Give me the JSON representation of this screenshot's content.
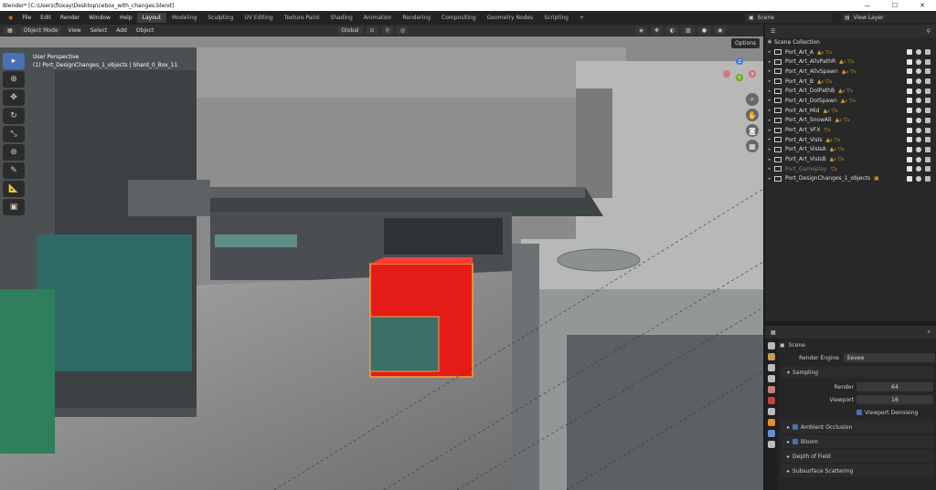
{
  "window": {
    "title": "Blender* [C:\\Users\\floxay\\Desktop\\cebox_with_changes.blend]",
    "controls": [
      "—",
      "☐",
      "✕"
    ]
  },
  "menu": {
    "items": [
      "File",
      "Edit",
      "Render",
      "Window",
      "Help"
    ],
    "workspaces": [
      "Layout",
      "Modeling",
      "Sculpting",
      "UV Editing",
      "Texture Paint",
      "Shading",
      "Animation",
      "Rendering",
      "Compositing",
      "Geometry Nodes",
      "Scripting"
    ],
    "add_tab": "+",
    "scene": "Scene",
    "view_layer": "View Layer"
  },
  "viewport": {
    "mode": "Object Mode",
    "menus": [
      "View",
      "Select",
      "Add",
      "Object"
    ],
    "orientation": "Global",
    "options_label": "Options",
    "view_name": "User Perspective",
    "object_info": "(1) Port_DesignChanges_1_objects | Shard_0_Box_11",
    "gizmo": {
      "x": "X",
      "y": "Y",
      "z": "Z"
    }
  },
  "outliner": {
    "root": "Scene Collection",
    "rows": [
      {
        "name": "Port_Art_A",
        "tags": "▲₈ ▽₈"
      },
      {
        "name": "Port_Art_AllvPathR",
        "tags": "▲₁ ▽₈"
      },
      {
        "name": "Port_Art_AllvSpawn",
        "tags": "▲₈ ▽₈"
      },
      {
        "name": "Port_Art_B",
        "tags": "▲₈ ▽₈"
      },
      {
        "name": "Port_Art_DolPathB",
        "tags": "▲₈ ▽₈"
      },
      {
        "name": "Port_Art_DolSpawn",
        "tags": "▲₈ ▽₈"
      },
      {
        "name": "Port_Art_Mid",
        "tags": "▲₈ ▽₈"
      },
      {
        "name": "Port_Art_SnowAll",
        "tags": "▲₈ ▽₈"
      },
      {
        "name": "Port_Art_VFX",
        "tags": "▽₈"
      },
      {
        "name": "Port_Art_VisIs",
        "tags": "▲₈ ▽₈"
      },
      {
        "name": "Port_Art_VisIsA",
        "tags": "▲₈ ▽₈"
      },
      {
        "name": "Port_Art_VisIsB",
        "tags": "▲₈ ▽₈"
      },
      {
        "name": "Port_Gameplay",
        "tags": "▽₈",
        "dim": true
      },
      {
        "name": "Port_DesignChanges_1_objects",
        "tags": "▣"
      }
    ]
  },
  "properties": {
    "scene_label": "Scene",
    "render_engine_label": "Render Engine",
    "render_engine_value": "Eevee",
    "sampling_label": "Sampling",
    "render_label": "Render",
    "render_value": "64",
    "viewport_label": "Viewport",
    "viewport_value": "16",
    "denoise_label": "Viewport Denoising",
    "sections": [
      "Ambient Occlusion",
      "Bloom",
      "Depth of Field",
      "Subsurface Scattering"
    ]
  },
  "colors": {
    "accent": "#4772b3",
    "selected_cube": "#e41b17",
    "outline": "#f2a23a",
    "viewport_bg": "#7d7d7d"
  }
}
